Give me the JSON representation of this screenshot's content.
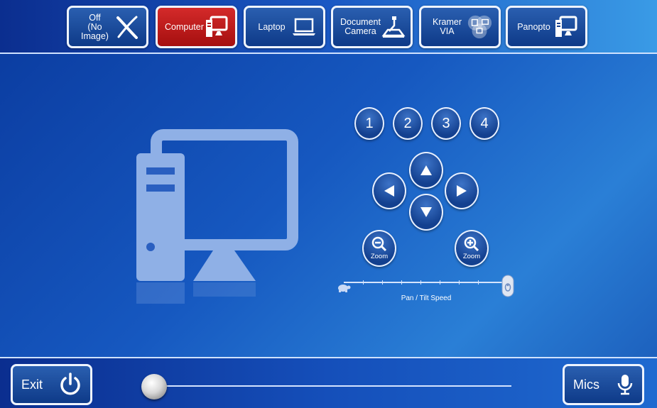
{
  "sources": [
    {
      "label": "Off\n(No Image)",
      "icon": "no-image-icon",
      "active": false
    },
    {
      "label": "Computer",
      "icon": "computer-icon",
      "active": true
    },
    {
      "label": "Laptop",
      "icon": "laptop-icon",
      "active": false
    },
    {
      "label": "Document\nCamera",
      "icon": "document-camera-icon",
      "active": false
    },
    {
      "label": "Kramer\nVIA",
      "icon": "kramer-via-icon",
      "active": false
    },
    {
      "label": "Panopto",
      "icon": "computer-icon",
      "active": false
    }
  ],
  "camera": {
    "presets": [
      "1",
      "2",
      "3",
      "4"
    ],
    "zoom_out_label": "Zoom",
    "zoom_in_label": "Zoom",
    "speed_label": "Pan / Tilt Speed",
    "speed_level": 1.0
  },
  "footer": {
    "exit_label": "Exit",
    "mics_label": "Mics",
    "volume_level": 0.0
  },
  "colors": {
    "active_source": "#c41d1d",
    "button_blue": "#13408f"
  }
}
